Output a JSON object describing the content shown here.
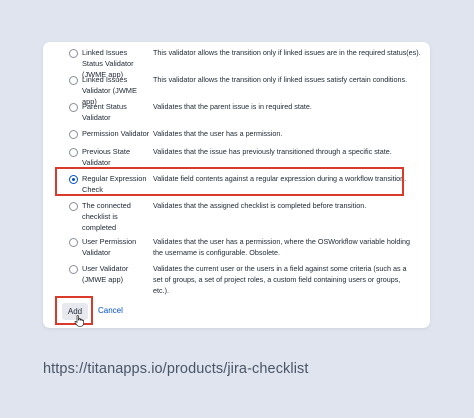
{
  "validators": [
    {
      "name": "Linked Issues Status Validator (JWME app)",
      "desc": "This validator allows the transition only if linked issues are in the required status(es).",
      "checked": false
    },
    {
      "name": "Linked Issues Validator (JWME app)",
      "desc": "This validator allows the transition only if linked issues satisfy certain conditions.",
      "checked": false
    },
    {
      "name": "Parent Status Validator",
      "desc": "Validates that the parent issue is in required state.",
      "checked": false
    },
    {
      "name": "Permission Validator",
      "desc": "Validates that the user has a permission.",
      "checked": false
    },
    {
      "name": "Previous State Validator",
      "desc": "Validates that the issue has previously transitioned through a specific state.",
      "checked": false
    },
    {
      "name": "Regular Expression Check",
      "desc": "Validate field contents against a regular expression during a workflow transition.",
      "checked": true
    },
    {
      "name": "The connected checklist is completed",
      "desc": "Validates that the assigned checklist is completed before transition.",
      "checked": false
    },
    {
      "name": "User Permission Validator",
      "desc": "Validates that the user has a permission, where the OSWorkflow variable holding the username is configurable. Obsolete.",
      "checked": false
    },
    {
      "name": "User Validator (JMWE app)",
      "desc": "Validates the current user or the users in a field against some criteria (such as a set of groups, a set of project roles, a custom field containing users or groups, etc.).",
      "checked": false
    }
  ],
  "actions": {
    "add_label": "Add",
    "cancel_label": "Cancel"
  },
  "footer": {
    "url": "https://titanapps.io/products/jira-checklist"
  },
  "colors": {
    "accent": "#0052cc",
    "highlight": "#d93a2b"
  }
}
